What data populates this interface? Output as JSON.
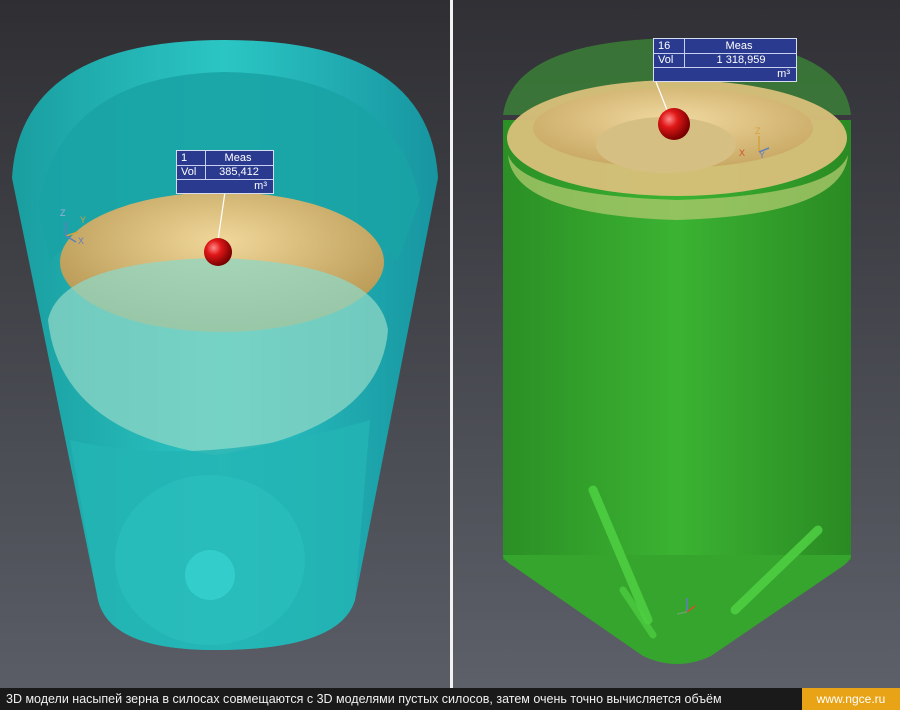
{
  "left_panel": {
    "measure": {
      "index": "1",
      "header": "Meas",
      "label": "Vol",
      "value": "385,412",
      "unit": "m³"
    },
    "axis_labels": {
      "z": "Z",
      "y": "Y",
      "x": "X"
    }
  },
  "right_panel": {
    "measure": {
      "index": "16",
      "header": "Meas",
      "label": "Vol",
      "value": "1 318,959",
      "unit": "m³"
    },
    "axis_labels": {
      "z": "Z",
      "y": "Y",
      "x": "X"
    }
  },
  "footer": {
    "caption": "3D модели насыпей зерна в силосах совмещаются с 3D моделями пустых силосов, затем очень точно вычисляется объём",
    "site": "www.ngce.ru"
  },
  "colors": {
    "cyan_silo": "#1fb5b3",
    "green_silo": "#2fa22a",
    "grain": "#e2c580",
    "marker": "#d81414",
    "accent": "#e8a317"
  }
}
